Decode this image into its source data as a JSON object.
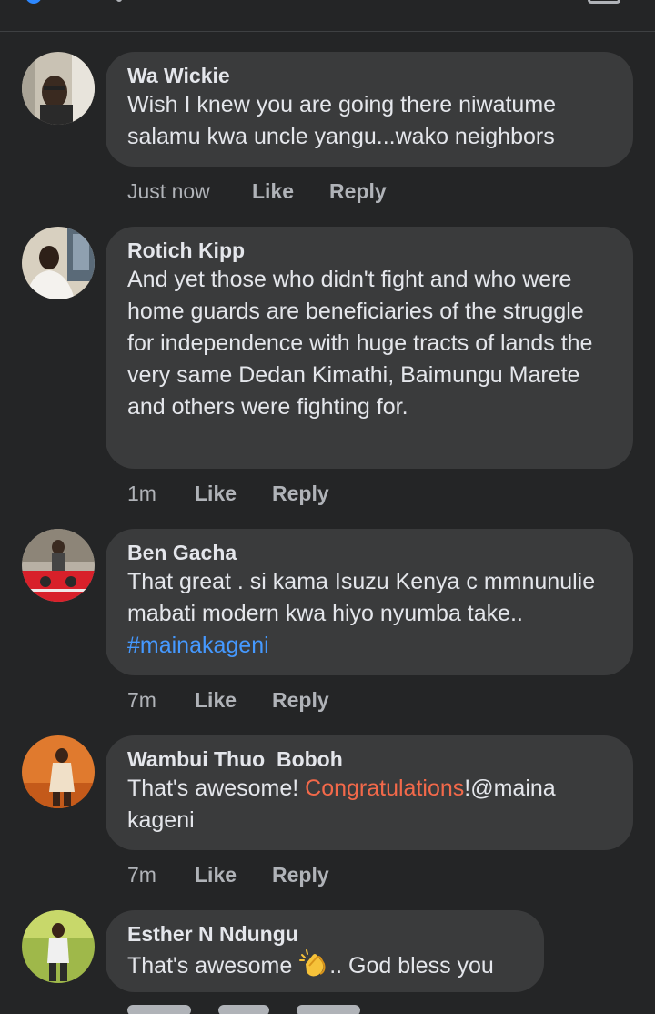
{
  "comments": [
    {
      "author": "Wa Wickie",
      "text": "Wish I knew you are going there niwatume salamu kwa uncle yangu...wako neighbors",
      "time": "Just now",
      "like_label": "Like",
      "reply_label": "Reply"
    },
    {
      "author": "Rotich Kipp",
      "text": "And yet those who didn't fight and who were home guards are beneficiaries of the struggle for independence with huge tracts of lands the very same Dedan Kimathi, Baimungu Marete and others were fighting for.",
      "time": "1m",
      "like_label": "Like",
      "reply_label": "Reply"
    },
    {
      "author": "Ben Gacha",
      "text": "That great . si kama Isuzu Kenya c mmnunulie mabati modern kwa hiyo nyumba take..",
      "hashtag": "#mainakageni",
      "time": "7m",
      "like_label": "Like",
      "reply_label": "Reply"
    },
    {
      "author": "Wambui Thuo  Boboh",
      "text_before": "That's awesome! ",
      "highlight": "Congratulations",
      "text_after": "!@maina kageni",
      "time": "7m",
      "like_label": "Like",
      "reply_label": "Reply"
    },
    {
      "author": "Esther N Ndungu",
      "text_before": "That's awesome ",
      "emoji": "clapping-hands-icon",
      "text_after": ".. God bless you"
    }
  ],
  "colors": {
    "background": "#242526",
    "bubble": "#3a3b3c",
    "text": "#e4e6eb",
    "secondary": "#b0b3b8",
    "hashtag": "#4599ff",
    "highlight": "#f3694a"
  }
}
